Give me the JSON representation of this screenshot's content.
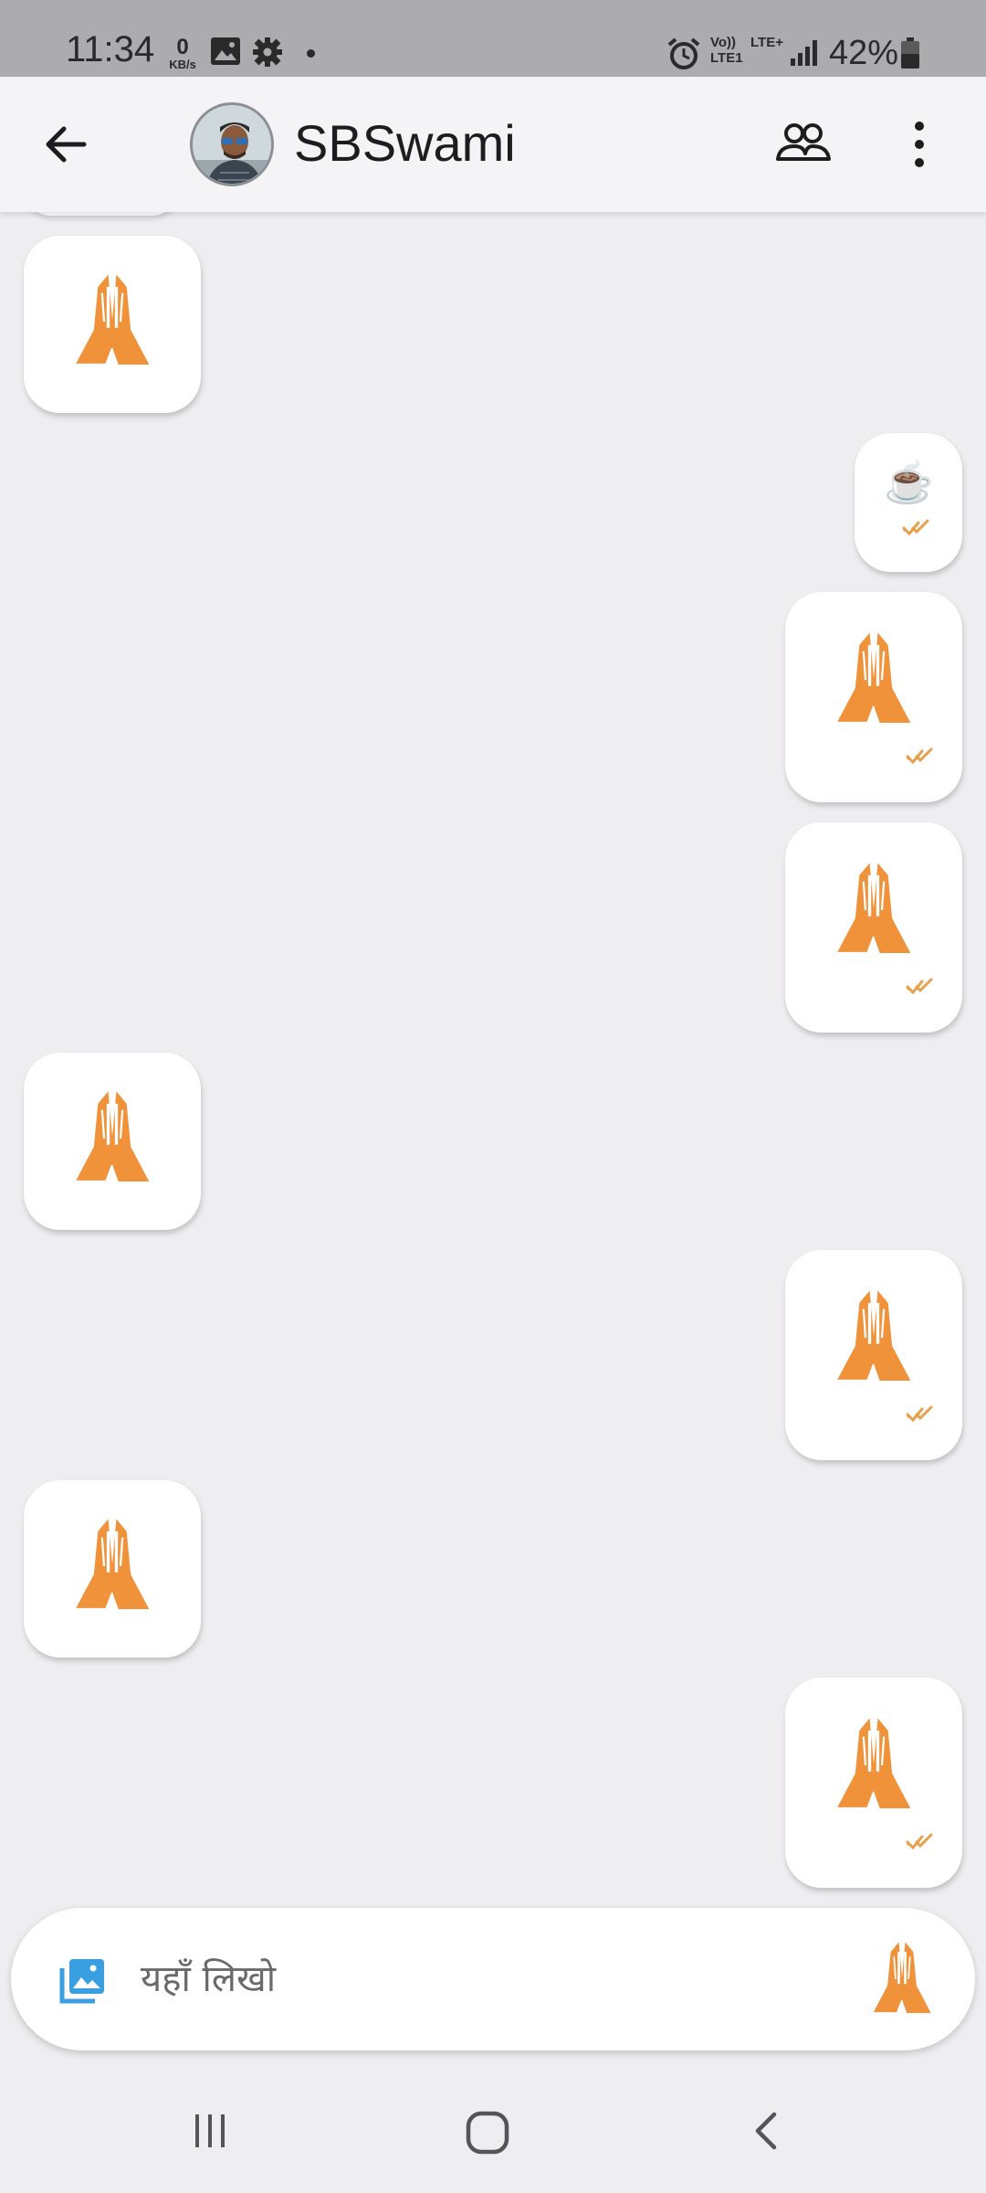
{
  "status_bar": {
    "time": "11:34",
    "speed_value": "0",
    "speed_unit": "KB/s",
    "network_line1": "Vo))",
    "network_line2": "LTE1",
    "network_line3": "LTE+",
    "battery": "42%",
    "icons": [
      "image-icon",
      "settings-icon",
      "alarm-icon",
      "signal-icon",
      "battery-icon"
    ]
  },
  "header": {
    "contact_name": "SBSwami",
    "icons": [
      "back-arrow-icon",
      "avatar",
      "group-icon",
      "more-vert-icon"
    ]
  },
  "messages": [
    {
      "direction": "incoming",
      "content": "folded-hands-emoji"
    },
    {
      "direction": "outgoing",
      "content": "☕",
      "status": "read"
    },
    {
      "direction": "outgoing",
      "content": "folded-hands-emoji",
      "status": "read"
    },
    {
      "direction": "outgoing",
      "content": "folded-hands-emoji",
      "status": "read"
    },
    {
      "direction": "incoming",
      "content": "folded-hands-emoji"
    },
    {
      "direction": "outgoing",
      "content": "folded-hands-emoji",
      "status": "read"
    },
    {
      "direction": "incoming",
      "content": "folded-hands-emoji"
    },
    {
      "direction": "outgoing",
      "content": "folded-hands-emoji",
      "status": "read"
    }
  ],
  "composer": {
    "placeholder": "यहाँ लिखो",
    "icons": [
      "gallery-icon",
      "folded-hands-send-icon"
    ]
  },
  "colors": {
    "accent_orange": "#f0923a",
    "tick_orange": "#e8a04c",
    "gallery_blue": "#3a9fe0",
    "chat_background": "#eeedf0"
  },
  "nav_bar": {
    "icons": [
      "recents-icon",
      "home-icon",
      "back-icon"
    ]
  }
}
